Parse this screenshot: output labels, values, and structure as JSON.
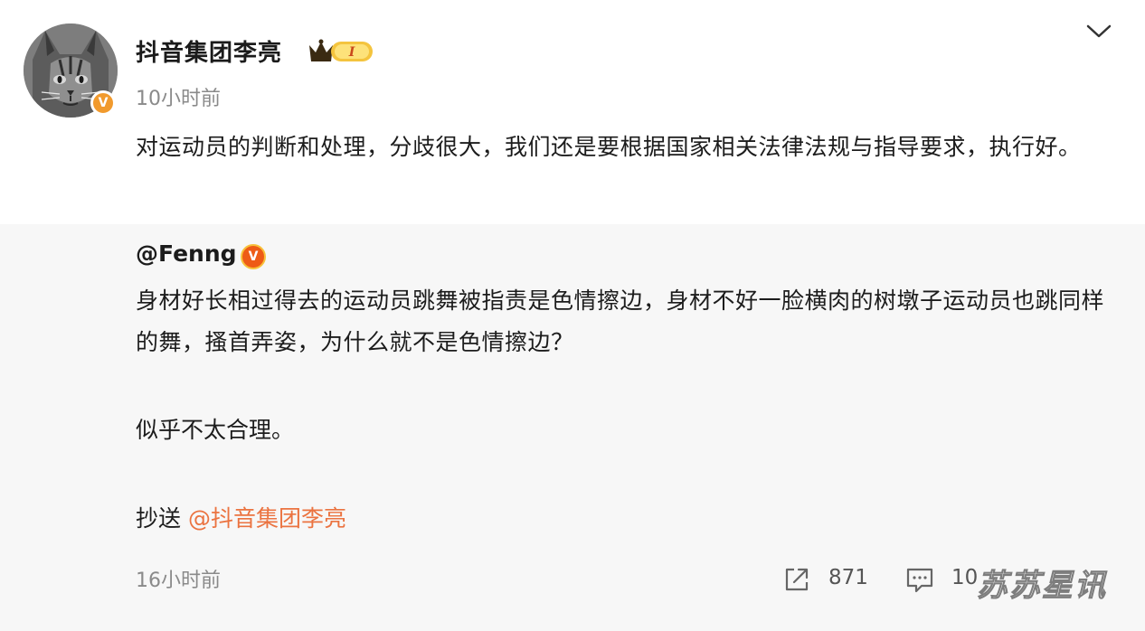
{
  "post": {
    "author": "抖音集团李亮",
    "crown_badge_text": "I",
    "time": "10小时前",
    "body": "对运动员的判断和处理，分歧很大，我们还是要根据国家相关法律法规与指导要求，执行好。",
    "badge_color": "#f19a2d"
  },
  "repost": {
    "author": "@Fenng",
    "badge_color": "#ee5b16",
    "paragraph1": "身材好长相过得去的运动员跳舞被指责是色情擦边，身材不好一脸横肉的树墩子运动员也跳同样的舞，搔首弄姿，为什么就不是色情擦边？",
    "paragraph2": "似乎不太合理。",
    "cc_prefix": "抄送 ",
    "cc_mention": "@抖音集团李亮",
    "time": "16小时前",
    "share_count": "871",
    "comment_count": "10",
    "mention_color": "#eb7340"
  },
  "icons": {
    "collapse": "chevron-down-icon",
    "share": "share-icon",
    "comment": "comment-icon",
    "verified": "verified-v-icon",
    "crown": "crown-badge-icon"
  },
  "watermark": "苏苏星讯"
}
